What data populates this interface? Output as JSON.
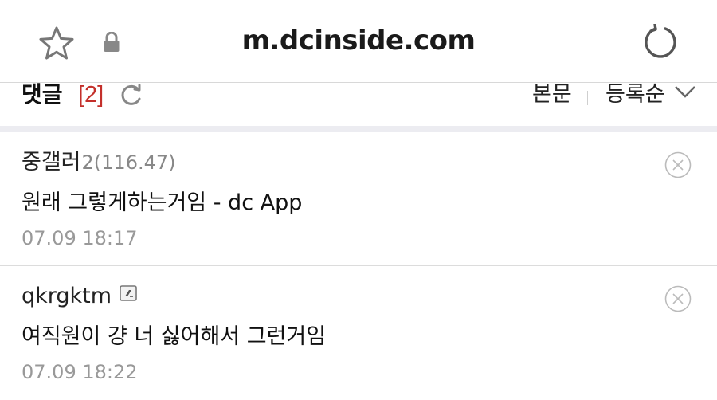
{
  "browser": {
    "url": "m.dcinside.com"
  },
  "comments_header": {
    "title": "댓글",
    "count": "[2]",
    "sort_body": "본문",
    "sort_selected": "등록순"
  },
  "comments": [
    {
      "author": "중갤러",
      "author_ip": "2(116.47)",
      "text": "원래 그렇게하는거임 - dc App",
      "date": "07.09 18:17"
    },
    {
      "author": "qkrgktm",
      "author_ip": "",
      "text": "여직원이 걍 너 싫어해서 그런거임",
      "date": "07.09 18:22"
    }
  ],
  "colors": {
    "count_red": "#c4302b",
    "icon_gray": "#777777",
    "date_gray": "#999999",
    "divider_band": "#ececf1"
  },
  "icons": [
    "star-icon",
    "lock-icon",
    "reload-icon",
    "refresh-icon",
    "chevron-down-icon",
    "delete-icon",
    "fixed-nick-icon"
  ]
}
